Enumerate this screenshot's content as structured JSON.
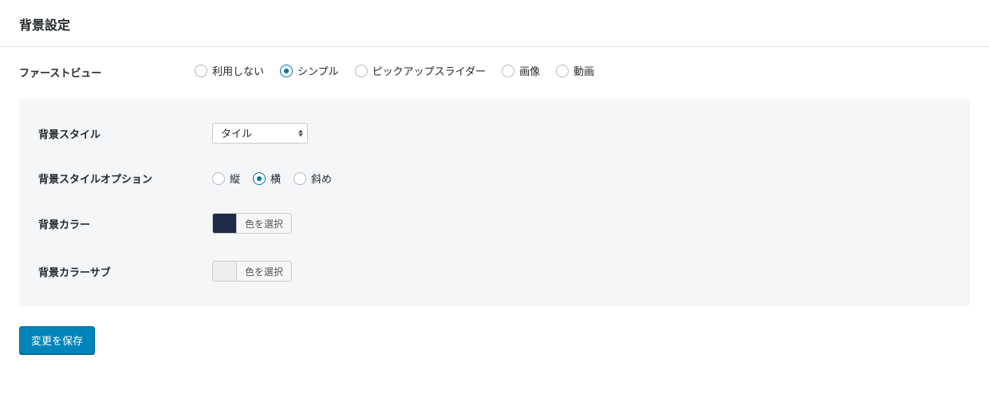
{
  "section": {
    "title": "背景設定"
  },
  "firstView": {
    "label": "ファーストビュー",
    "options": {
      "none": "利用しない",
      "simple": "シンプル",
      "pickup": "ピックアップスライダー",
      "image": "画像",
      "video": "動画"
    },
    "selected": "simple"
  },
  "panel": {
    "bgStyle": {
      "label": "背景スタイル",
      "selected": "タイル"
    },
    "bgStyleOption": {
      "label": "背景スタイルオプション",
      "options": {
        "v": "縦",
        "h": "横",
        "d": "斜め"
      },
      "selected": "h"
    },
    "bgColor": {
      "label": "背景カラー",
      "swatch": "#1e2a47",
      "buttonLabel": "色を選択"
    },
    "bgColorSub": {
      "label": "背景カラーサブ",
      "swatch": "#eeeeee",
      "buttonLabel": "色を選択"
    }
  },
  "save": {
    "label": "変更を保存"
  }
}
